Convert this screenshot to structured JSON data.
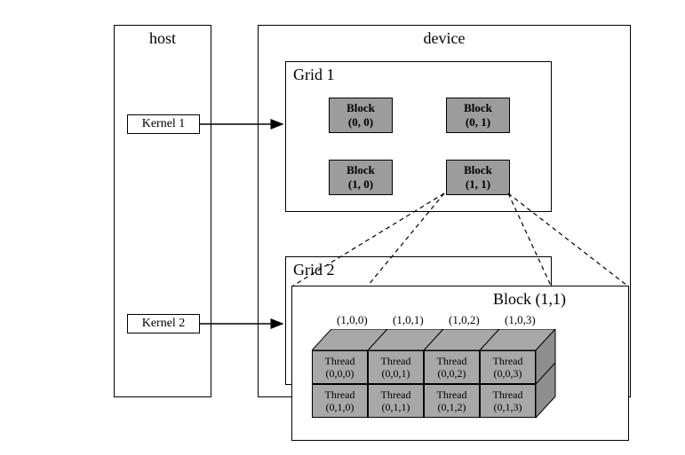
{
  "host": {
    "title": "host",
    "kernels": [
      "Kernel 1",
      "Kernel 2"
    ]
  },
  "device": {
    "title": "device",
    "grids": [
      {
        "title": "Grid 1",
        "blocks": [
          {
            "label": "Block",
            "coord": "(0, 0)"
          },
          {
            "label": "Block",
            "coord": "(0, 1)"
          },
          {
            "label": "Block",
            "coord": "(1, 0)"
          },
          {
            "label": "Block",
            "coord": "(1, 1)"
          }
        ]
      },
      {
        "title": "Grid 2"
      }
    ]
  },
  "detail": {
    "title": "Block (1,1)",
    "top_coords": [
      "(1,0,0)",
      "(1,0,1)",
      "(1,0,2)",
      "(1,0,3)"
    ],
    "threads_row0": [
      {
        "label": "Thread",
        "coord": "(0,0,0)"
      },
      {
        "label": "Thread",
        "coord": "(0,0,1)"
      },
      {
        "label": "Thread",
        "coord": "(0,0,2)"
      },
      {
        "label": "Thread",
        "coord": "(0,0,3)"
      }
    ],
    "threads_row1": [
      {
        "label": "Thread",
        "coord": "(0,1,0)"
      },
      {
        "label": "Thread",
        "coord": "(0,1,1)"
      },
      {
        "label": "Thread",
        "coord": "(0,1,2)"
      },
      {
        "label": "Thread",
        "coord": "(0,1,3)"
      }
    ]
  }
}
